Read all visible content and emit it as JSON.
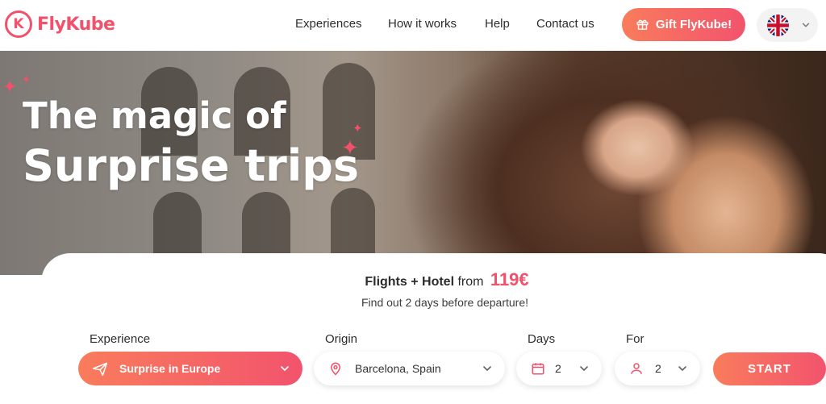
{
  "brand": {
    "name": "FlyKube",
    "mark": "K"
  },
  "nav": {
    "experiences": "Experiences",
    "how_it_works": "How it works",
    "help": "Help",
    "contact": "Contact us"
  },
  "gift_button": "Gift FlyKube!",
  "language": {
    "icon": "uk-flag-icon"
  },
  "hero": {
    "line1": "The magic of",
    "line2": "Surprise trips"
  },
  "offer": {
    "label": "Flights + Hotel",
    "from": "from",
    "price": "119€",
    "subtitle": "Find out 2 days before departure!"
  },
  "search": {
    "experience_label": "Experience",
    "experience_value": "Surprise in Europe",
    "origin_label": "Origin",
    "origin_value": "Barcelona, Spain",
    "days_label": "Days",
    "days_value": "2",
    "for_label": "For",
    "for_value": "2",
    "start_label": "START"
  },
  "colors": {
    "accent": "#f2516b",
    "accent_light": "#f97c5c"
  }
}
